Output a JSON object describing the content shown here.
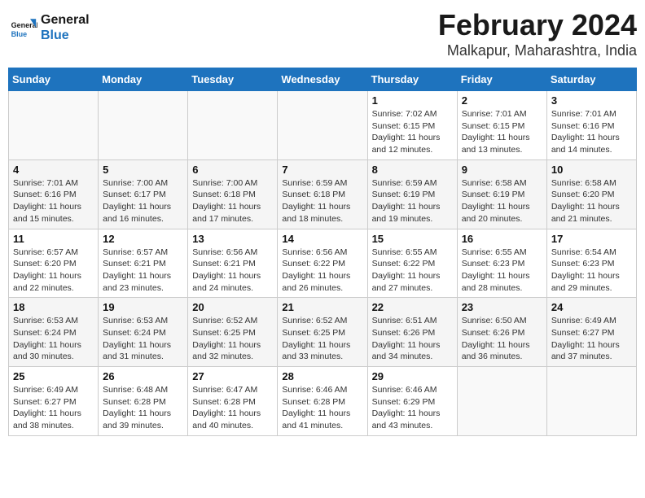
{
  "logo": {
    "line1": "General",
    "line2": "Blue"
  },
  "title": "February 2024",
  "location": "Malkapur, Maharashtra, India",
  "days_of_week": [
    "Sunday",
    "Monday",
    "Tuesday",
    "Wednesday",
    "Thursday",
    "Friday",
    "Saturday"
  ],
  "weeks": [
    [
      {
        "day": "",
        "info": ""
      },
      {
        "day": "",
        "info": ""
      },
      {
        "day": "",
        "info": ""
      },
      {
        "day": "",
        "info": ""
      },
      {
        "day": "1",
        "info": "Sunrise: 7:02 AM\nSunset: 6:15 PM\nDaylight: 11 hours\nand 12 minutes."
      },
      {
        "day": "2",
        "info": "Sunrise: 7:01 AM\nSunset: 6:15 PM\nDaylight: 11 hours\nand 13 minutes."
      },
      {
        "day": "3",
        "info": "Sunrise: 7:01 AM\nSunset: 6:16 PM\nDaylight: 11 hours\nand 14 minutes."
      }
    ],
    [
      {
        "day": "4",
        "info": "Sunrise: 7:01 AM\nSunset: 6:16 PM\nDaylight: 11 hours\nand 15 minutes."
      },
      {
        "day": "5",
        "info": "Sunrise: 7:00 AM\nSunset: 6:17 PM\nDaylight: 11 hours\nand 16 minutes."
      },
      {
        "day": "6",
        "info": "Sunrise: 7:00 AM\nSunset: 6:18 PM\nDaylight: 11 hours\nand 17 minutes."
      },
      {
        "day": "7",
        "info": "Sunrise: 6:59 AM\nSunset: 6:18 PM\nDaylight: 11 hours\nand 18 minutes."
      },
      {
        "day": "8",
        "info": "Sunrise: 6:59 AM\nSunset: 6:19 PM\nDaylight: 11 hours\nand 19 minutes."
      },
      {
        "day": "9",
        "info": "Sunrise: 6:58 AM\nSunset: 6:19 PM\nDaylight: 11 hours\nand 20 minutes."
      },
      {
        "day": "10",
        "info": "Sunrise: 6:58 AM\nSunset: 6:20 PM\nDaylight: 11 hours\nand 21 minutes."
      }
    ],
    [
      {
        "day": "11",
        "info": "Sunrise: 6:57 AM\nSunset: 6:20 PM\nDaylight: 11 hours\nand 22 minutes."
      },
      {
        "day": "12",
        "info": "Sunrise: 6:57 AM\nSunset: 6:21 PM\nDaylight: 11 hours\nand 23 minutes."
      },
      {
        "day": "13",
        "info": "Sunrise: 6:56 AM\nSunset: 6:21 PM\nDaylight: 11 hours\nand 24 minutes."
      },
      {
        "day": "14",
        "info": "Sunrise: 6:56 AM\nSunset: 6:22 PM\nDaylight: 11 hours\nand 26 minutes."
      },
      {
        "day": "15",
        "info": "Sunrise: 6:55 AM\nSunset: 6:22 PM\nDaylight: 11 hours\nand 27 minutes."
      },
      {
        "day": "16",
        "info": "Sunrise: 6:55 AM\nSunset: 6:23 PM\nDaylight: 11 hours\nand 28 minutes."
      },
      {
        "day": "17",
        "info": "Sunrise: 6:54 AM\nSunset: 6:23 PM\nDaylight: 11 hours\nand 29 minutes."
      }
    ],
    [
      {
        "day": "18",
        "info": "Sunrise: 6:53 AM\nSunset: 6:24 PM\nDaylight: 11 hours\nand 30 minutes."
      },
      {
        "day": "19",
        "info": "Sunrise: 6:53 AM\nSunset: 6:24 PM\nDaylight: 11 hours\nand 31 minutes."
      },
      {
        "day": "20",
        "info": "Sunrise: 6:52 AM\nSunset: 6:25 PM\nDaylight: 11 hours\nand 32 minutes."
      },
      {
        "day": "21",
        "info": "Sunrise: 6:52 AM\nSunset: 6:25 PM\nDaylight: 11 hours\nand 33 minutes."
      },
      {
        "day": "22",
        "info": "Sunrise: 6:51 AM\nSunset: 6:26 PM\nDaylight: 11 hours\nand 34 minutes."
      },
      {
        "day": "23",
        "info": "Sunrise: 6:50 AM\nSunset: 6:26 PM\nDaylight: 11 hours\nand 36 minutes."
      },
      {
        "day": "24",
        "info": "Sunrise: 6:49 AM\nSunset: 6:27 PM\nDaylight: 11 hours\nand 37 minutes."
      }
    ],
    [
      {
        "day": "25",
        "info": "Sunrise: 6:49 AM\nSunset: 6:27 PM\nDaylight: 11 hours\nand 38 minutes."
      },
      {
        "day": "26",
        "info": "Sunrise: 6:48 AM\nSunset: 6:28 PM\nDaylight: 11 hours\nand 39 minutes."
      },
      {
        "day": "27",
        "info": "Sunrise: 6:47 AM\nSunset: 6:28 PM\nDaylight: 11 hours\nand 40 minutes."
      },
      {
        "day": "28",
        "info": "Sunrise: 6:46 AM\nSunset: 6:28 PM\nDaylight: 11 hours\nand 41 minutes."
      },
      {
        "day": "29",
        "info": "Sunrise: 6:46 AM\nSunset: 6:29 PM\nDaylight: 11 hours\nand 43 minutes."
      },
      {
        "day": "",
        "info": ""
      },
      {
        "day": "",
        "info": ""
      }
    ]
  ]
}
